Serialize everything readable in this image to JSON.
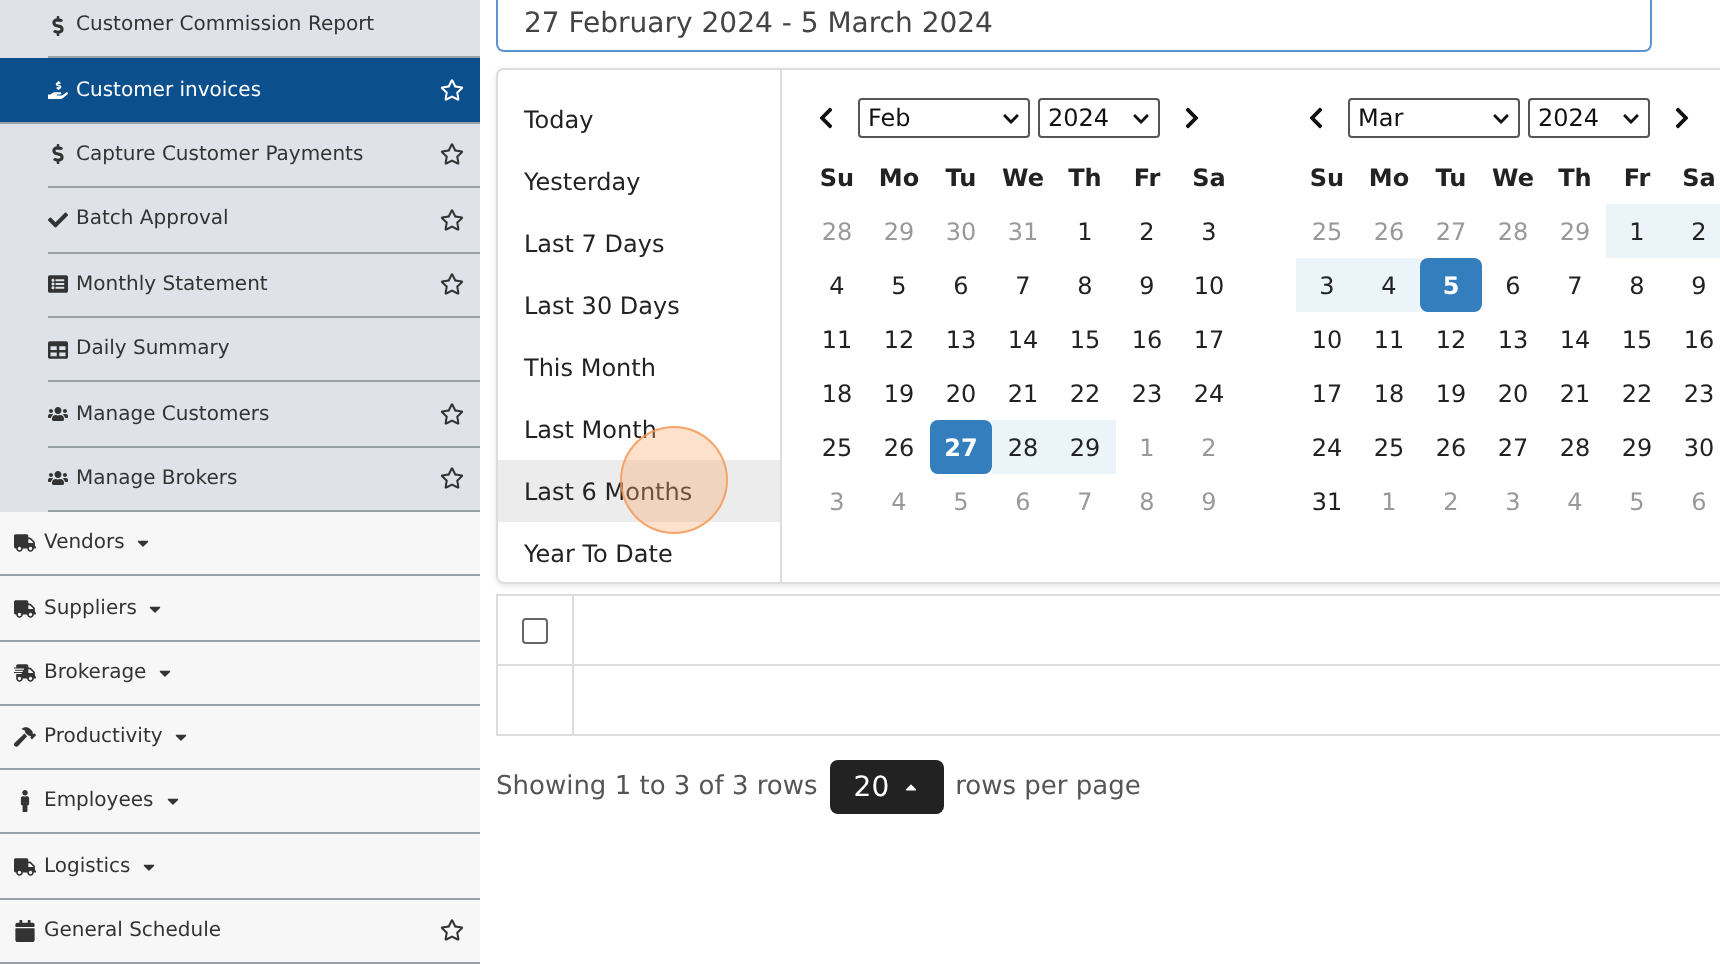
{
  "sidebar": {
    "submenu_items": [
      {
        "label": "Customer Commission Report",
        "selected": false,
        "star": false
      },
      {
        "label": "Customer invoices",
        "selected": true,
        "star": true
      },
      {
        "label": "Capture Customer Payments",
        "selected": false,
        "star": true
      },
      {
        "label": "Batch Approval",
        "selected": false,
        "star": true
      },
      {
        "label": "Monthly Statement",
        "selected": false,
        "star": true
      },
      {
        "label": "Daily Summary",
        "selected": false,
        "star": false
      },
      {
        "label": "Manage Customers",
        "selected": false,
        "star": true
      },
      {
        "label": "Manage Brokers",
        "selected": false,
        "star": true
      }
    ],
    "items": [
      {
        "label": "Vendors",
        "dropdown": true,
        "star": false
      },
      {
        "label": "Suppliers",
        "dropdown": true,
        "star": false
      },
      {
        "label": "Brokerage",
        "dropdown": true,
        "star": false
      },
      {
        "label": "Productivity",
        "dropdown": true,
        "star": false
      },
      {
        "label": "Employees",
        "dropdown": true,
        "star": false
      },
      {
        "label": "Logistics",
        "dropdown": true,
        "star": false
      },
      {
        "label": "General Schedule",
        "dropdown": false,
        "star": true
      }
    ]
  },
  "date_field": {
    "value": "27 February 2024 - 5 March 2024"
  },
  "ranges": [
    {
      "label": "Today",
      "hovered": false
    },
    {
      "label": "Yesterday",
      "hovered": false
    },
    {
      "label": "Last 7 Days",
      "hovered": false
    },
    {
      "label": "Last 30 Days",
      "hovered": false
    },
    {
      "label": "This Month",
      "hovered": false
    },
    {
      "label": "Last Month",
      "hovered": false
    },
    {
      "label": "Last 6 Months",
      "hovered": true
    },
    {
      "label": "Year To Date",
      "hovered": false
    }
  ],
  "calendars": [
    {
      "month": "Feb",
      "year": "2024",
      "weekdays": [
        "Su",
        "Mo",
        "Tu",
        "We",
        "Th",
        "Fr",
        "Sa"
      ],
      "weeks": [
        [
          {
            "day": "28",
            "outside": true,
            "selected": false,
            "in_range": false
          },
          {
            "day": "29",
            "outside": true,
            "selected": false,
            "in_range": false
          },
          {
            "day": "30",
            "outside": true,
            "selected": false,
            "in_range": false
          },
          {
            "day": "31",
            "outside": true,
            "selected": false,
            "in_range": false
          },
          {
            "day": "1",
            "outside": false,
            "selected": false,
            "in_range": false
          },
          {
            "day": "2",
            "outside": false,
            "selected": false,
            "in_range": false
          },
          {
            "day": "3",
            "outside": false,
            "selected": false,
            "in_range": false
          }
        ],
        [
          {
            "day": "4",
            "outside": false,
            "selected": false,
            "in_range": false
          },
          {
            "day": "5",
            "outside": false,
            "selected": false,
            "in_range": false
          },
          {
            "day": "6",
            "outside": false,
            "selected": false,
            "in_range": false
          },
          {
            "day": "7",
            "outside": false,
            "selected": false,
            "in_range": false
          },
          {
            "day": "8",
            "outside": false,
            "selected": false,
            "in_range": false
          },
          {
            "day": "9",
            "outside": false,
            "selected": false,
            "in_range": false
          },
          {
            "day": "10",
            "outside": false,
            "selected": false,
            "in_range": false
          }
        ],
        [
          {
            "day": "11",
            "outside": false,
            "selected": false,
            "in_range": false
          },
          {
            "day": "12",
            "outside": false,
            "selected": false,
            "in_range": false
          },
          {
            "day": "13",
            "outside": false,
            "selected": false,
            "in_range": false
          },
          {
            "day": "14",
            "outside": false,
            "selected": false,
            "in_range": false
          },
          {
            "day": "15",
            "outside": false,
            "selected": false,
            "in_range": false
          },
          {
            "day": "16",
            "outside": false,
            "selected": false,
            "in_range": false
          },
          {
            "day": "17",
            "outside": false,
            "selected": false,
            "in_range": false
          }
        ],
        [
          {
            "day": "18",
            "outside": false,
            "selected": false,
            "in_range": false
          },
          {
            "day": "19",
            "outside": false,
            "selected": false,
            "in_range": false
          },
          {
            "day": "20",
            "outside": false,
            "selected": false,
            "in_range": false
          },
          {
            "day": "21",
            "outside": false,
            "selected": false,
            "in_range": false
          },
          {
            "day": "22",
            "outside": false,
            "selected": false,
            "in_range": false
          },
          {
            "day": "23",
            "outside": false,
            "selected": false,
            "in_range": false
          },
          {
            "day": "24",
            "outside": false,
            "selected": false,
            "in_range": false
          }
        ],
        [
          {
            "day": "25",
            "outside": false,
            "selected": false,
            "in_range": false
          },
          {
            "day": "26",
            "outside": false,
            "selected": false,
            "in_range": false
          },
          {
            "day": "27",
            "outside": false,
            "selected": true,
            "in_range": false
          },
          {
            "day": "28",
            "outside": false,
            "selected": false,
            "in_range": true
          },
          {
            "day": "29",
            "outside": false,
            "selected": false,
            "in_range": true
          },
          {
            "day": "1",
            "outside": true,
            "selected": false,
            "in_range": false
          },
          {
            "day": "2",
            "outside": true,
            "selected": false,
            "in_range": false
          }
        ],
        [
          {
            "day": "3",
            "outside": true,
            "selected": false,
            "in_range": false
          },
          {
            "day": "4",
            "outside": true,
            "selected": false,
            "in_range": false
          },
          {
            "day": "5",
            "outside": true,
            "selected": false,
            "in_range": false
          },
          {
            "day": "6",
            "outside": true,
            "selected": false,
            "in_range": false
          },
          {
            "day": "7",
            "outside": true,
            "selected": false,
            "in_range": false
          },
          {
            "day": "8",
            "outside": true,
            "selected": false,
            "in_range": false
          },
          {
            "day": "9",
            "outside": true,
            "selected": false,
            "in_range": false
          }
        ]
      ]
    },
    {
      "month": "Mar",
      "year": "2024",
      "weekdays": [
        "Su",
        "Mo",
        "Tu",
        "We",
        "Th",
        "Fr",
        "Sa"
      ],
      "weeks": [
        [
          {
            "day": "25",
            "outside": true,
            "selected": false,
            "in_range": false
          },
          {
            "day": "26",
            "outside": true,
            "selected": false,
            "in_range": false
          },
          {
            "day": "27",
            "outside": true,
            "selected": false,
            "in_range": false
          },
          {
            "day": "28",
            "outside": true,
            "selected": false,
            "in_range": false
          },
          {
            "day": "29",
            "outside": true,
            "selected": false,
            "in_range": false
          },
          {
            "day": "1",
            "outside": false,
            "selected": false,
            "in_range": true
          },
          {
            "day": "2",
            "outside": false,
            "selected": false,
            "in_range": true
          }
        ],
        [
          {
            "day": "3",
            "outside": false,
            "selected": false,
            "in_range": true
          },
          {
            "day": "4",
            "outside": false,
            "selected": false,
            "in_range": true
          },
          {
            "day": "5",
            "outside": false,
            "selected": true,
            "in_range": false
          },
          {
            "day": "6",
            "outside": false,
            "selected": false,
            "in_range": false
          },
          {
            "day": "7",
            "outside": false,
            "selected": false,
            "in_range": false
          },
          {
            "day": "8",
            "outside": false,
            "selected": false,
            "in_range": false
          },
          {
            "day": "9",
            "outside": false,
            "selected": false,
            "in_range": false
          }
        ],
        [
          {
            "day": "10",
            "outside": false,
            "selected": false,
            "in_range": false
          },
          {
            "day": "11",
            "outside": false,
            "selected": false,
            "in_range": false
          },
          {
            "day": "12",
            "outside": false,
            "selected": false,
            "in_range": false
          },
          {
            "day": "13",
            "outside": false,
            "selected": false,
            "in_range": false
          },
          {
            "day": "14",
            "outside": false,
            "selected": false,
            "in_range": false
          },
          {
            "day": "15",
            "outside": false,
            "selected": false,
            "in_range": false
          },
          {
            "day": "16",
            "outside": false,
            "selected": false,
            "in_range": false
          }
        ],
        [
          {
            "day": "17",
            "outside": false,
            "selected": false,
            "in_range": false
          },
          {
            "day": "18",
            "outside": false,
            "selected": false,
            "in_range": false
          },
          {
            "day": "19",
            "outside": false,
            "selected": false,
            "in_range": false
          },
          {
            "day": "20",
            "outside": false,
            "selected": false,
            "in_range": false
          },
          {
            "day": "21",
            "outside": false,
            "selected": false,
            "in_range": false
          },
          {
            "day": "22",
            "outside": false,
            "selected": false,
            "in_range": false
          },
          {
            "day": "23",
            "outside": false,
            "selected": false,
            "in_range": false
          }
        ],
        [
          {
            "day": "24",
            "outside": false,
            "selected": false,
            "in_range": false
          },
          {
            "day": "25",
            "outside": false,
            "selected": false,
            "in_range": false
          },
          {
            "day": "26",
            "outside": false,
            "selected": false,
            "in_range": false
          },
          {
            "day": "27",
            "outside": false,
            "selected": false,
            "in_range": false
          },
          {
            "day": "28",
            "outside": false,
            "selected": false,
            "in_range": false
          },
          {
            "day": "29",
            "outside": false,
            "selected": false,
            "in_range": false
          },
          {
            "day": "30",
            "outside": false,
            "selected": false,
            "in_range": false
          }
        ],
        [
          {
            "day": "31",
            "outside": false,
            "selected": false,
            "in_range": false
          },
          {
            "day": "1",
            "outside": true,
            "selected": false,
            "in_range": false
          },
          {
            "day": "2",
            "outside": true,
            "selected": false,
            "in_range": false
          },
          {
            "day": "3",
            "outside": true,
            "selected": false,
            "in_range": false
          },
          {
            "day": "4",
            "outside": true,
            "selected": false,
            "in_range": false
          },
          {
            "day": "5",
            "outside": true,
            "selected": false,
            "in_range": false
          },
          {
            "day": "6",
            "outside": true,
            "selected": false,
            "in_range": false
          }
        ]
      ]
    }
  ],
  "table": {
    "rows": [
      {
        "kind": "checkbox",
        "checked": false
      },
      {
        "kind": "empty"
      }
    ]
  },
  "pagination": {
    "summary": "Showing 1 to 3 of 3 rows",
    "page_size": "20",
    "suffix": "rows per page"
  }
}
